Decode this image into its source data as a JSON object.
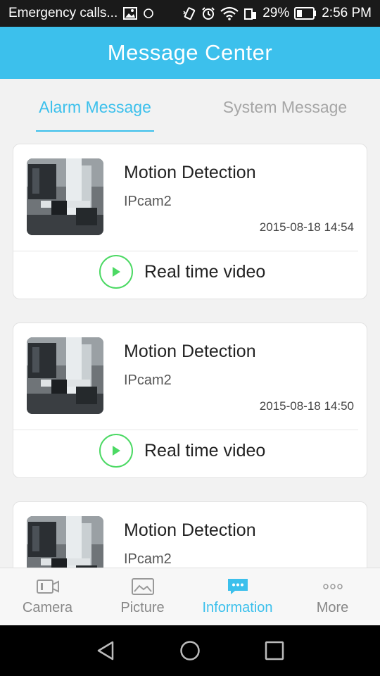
{
  "status_bar": {
    "carrier": "Emergency calls...",
    "battery": "29%",
    "time": "2:56 PM"
  },
  "header": {
    "title": "Message Center"
  },
  "tabs": [
    {
      "label": "Alarm Message",
      "active": true
    },
    {
      "label": "System Message",
      "active": false
    }
  ],
  "messages": [
    {
      "title": "Motion Detection",
      "camera": "IPcam2",
      "time": "2015-08-18 14:54",
      "action_label": "Real time video"
    },
    {
      "title": "Motion Detection",
      "camera": "IPcam2",
      "time": "2015-08-18 14:50",
      "action_label": "Real time video"
    },
    {
      "title": "Motion Detection",
      "camera": "IPcam2"
    }
  ],
  "bottom_nav": [
    {
      "label": "Camera",
      "icon": "camera-icon",
      "active": false
    },
    {
      "label": "Picture",
      "icon": "picture-icon",
      "active": false
    },
    {
      "label": "Information",
      "icon": "chat-bubble-icon",
      "active": true
    },
    {
      "label": "More",
      "icon": "more-dots-icon",
      "active": false
    }
  ],
  "colors": {
    "accent": "#3cc0ec",
    "play_green": "#4cd964",
    "status_bar_bg": "#1a1a1a"
  }
}
